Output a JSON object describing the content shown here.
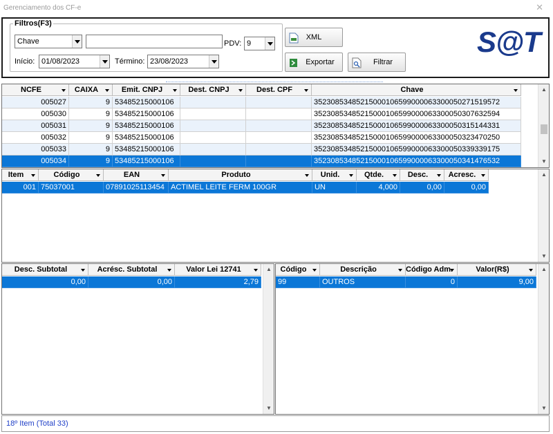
{
  "window": {
    "title": "Gerenciamento dos CF-e",
    "close_glyph": "✕"
  },
  "filters": {
    "legend": "Filtros(F3)",
    "field_select": "Chave",
    "search_value": "",
    "pdv_label": "PDV:",
    "pdv_value": "9",
    "start_label": "Início:",
    "start_value": "01/08/2023",
    "end_label": "Término:",
    "end_value": "23/08/2023"
  },
  "buttons": {
    "xml": "XML",
    "export": "Exportar",
    "filter": "Filtrar"
  },
  "logo": {
    "text": "S@T",
    "color": "#1a3a8c"
  },
  "colors": {
    "selection": "#0b77d7",
    "alt_row": "#eaf2fb",
    "status_text": "#1f3fc7"
  },
  "notes_grid": {
    "headers": [
      "NCFE",
      "CAIXA",
      "Emit. CNPJ",
      "Dest. CNPJ",
      "Dest. CPF",
      "Chave"
    ],
    "rows": [
      [
        "005027",
        "9",
        "53485215000106",
        "",
        "",
        "35230853485215000106599000063300050271519572"
      ],
      [
        "005030",
        "9",
        "53485215000106",
        "",
        "",
        "35230853485215000106599000063300050307632594"
      ],
      [
        "005031",
        "9",
        "53485215000106",
        "",
        "",
        "35230853485215000106599000063300050315144331"
      ],
      [
        "005032",
        "9",
        "53485215000106",
        "",
        "",
        "35230853485215000106599000063300050323470250"
      ],
      [
        "005033",
        "9",
        "53485215000106",
        "",
        "",
        "35230853485215000106599000063300050339339175"
      ],
      [
        "005034",
        "9",
        "53485215000106",
        "",
        "",
        "35230853485215000106599000063300050341476532"
      ]
    ],
    "selected_row": 5
  },
  "items_grid": {
    "headers": [
      "Item",
      "Código",
      "EAN",
      "Produto",
      "Unid.",
      "Qtde.",
      "Desc.",
      "Acresc."
    ],
    "rows": [
      [
        "001",
        "75037001",
        "07891025113454",
        "ACTIMEL LEITE FERM 100GR",
        "UN",
        "4,000",
        "0,00",
        "0,00"
      ]
    ]
  },
  "totals_grid": {
    "headers": [
      "Desc. Subtotal",
      "Acrésc. Subtotal",
      "Valor Lei 12741"
    ],
    "rows": [
      [
        "0,00",
        "0,00",
        "2,79"
      ]
    ]
  },
  "payments_grid": {
    "headers": [
      "Código",
      "Descrição",
      "Código Adm.",
      "Valor(R$)"
    ],
    "rows": [
      [
        "99",
        "OUTROS",
        "0",
        "9,00"
      ]
    ]
  },
  "status": {
    "text": "18º Item (Total 33)"
  }
}
